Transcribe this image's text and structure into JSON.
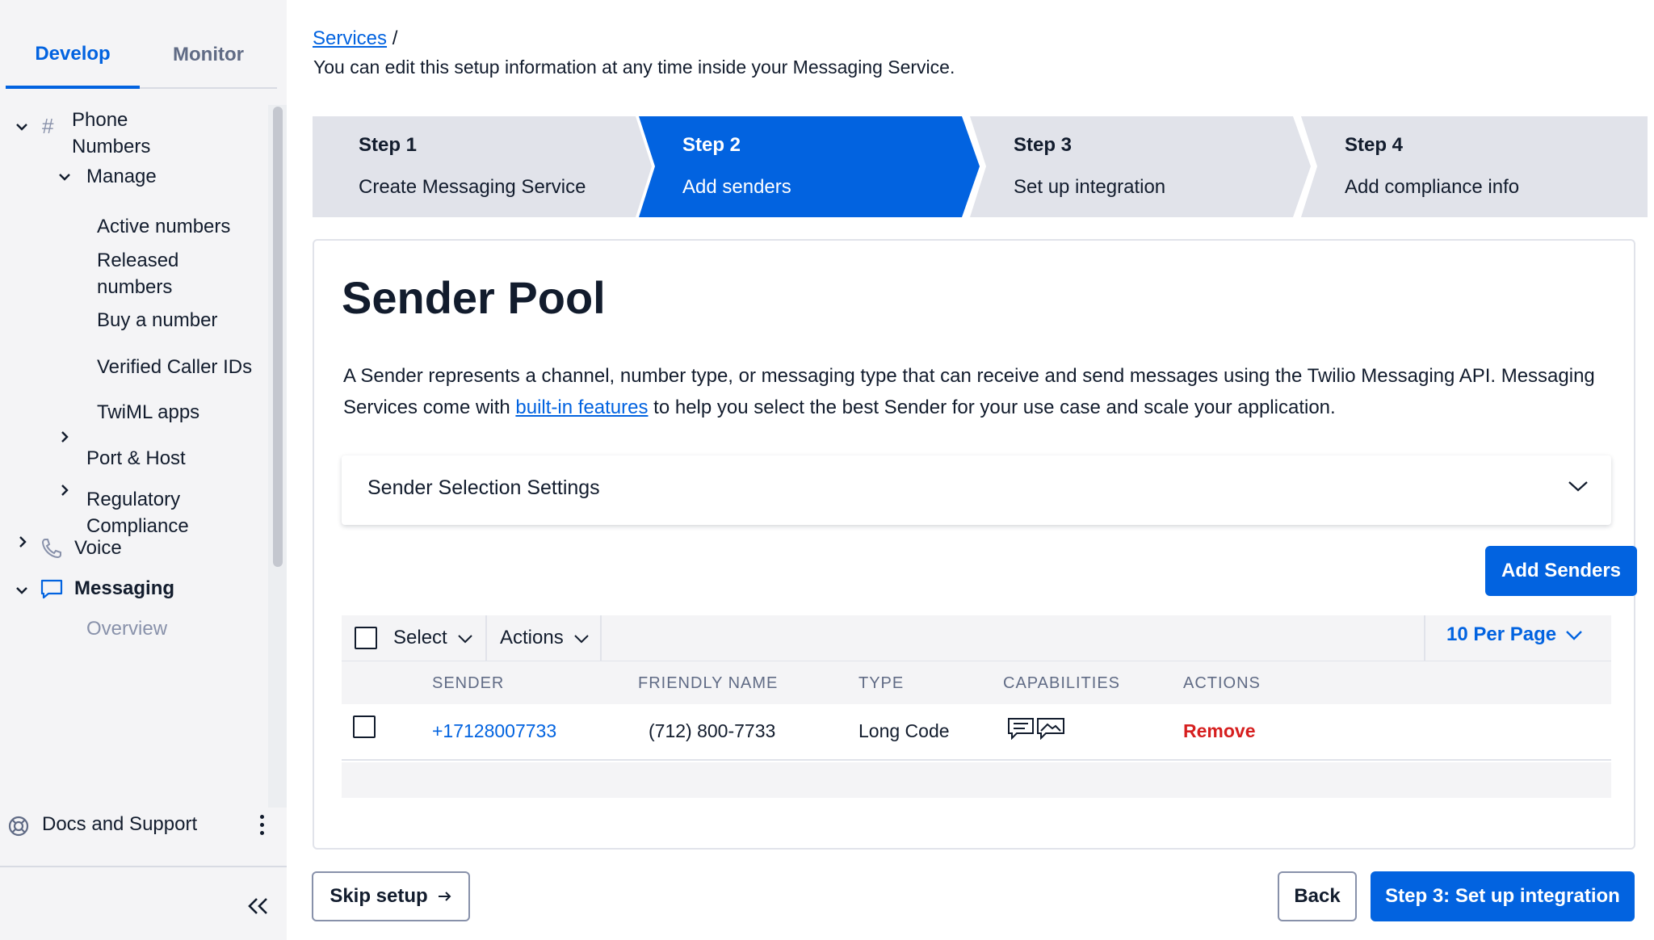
{
  "sidebar": {
    "tabs": [
      {
        "label": "Develop",
        "active": true
      },
      {
        "label": "Monitor",
        "active": false
      }
    ],
    "items": {
      "phone_numbers": "Phone\nNumbers",
      "phone_numbers_line1": "Phone",
      "phone_numbers_line2": "Numbers",
      "manage": "Manage",
      "active_numbers": "Active numbers",
      "released_line1": "Released",
      "released_line2": "numbers",
      "buy_number": "Buy a number",
      "verified_caller_ids": "Verified Caller IDs",
      "twiml_apps": "TwiML apps",
      "port_host": "Port & Host",
      "regulatory_line1": "Regulatory",
      "regulatory_line2": "Compliance",
      "voice": "Voice",
      "messaging": "Messaging",
      "overview": "Overview"
    },
    "docs_support": "Docs and Support"
  },
  "breadcrumb": {
    "link": "Services",
    "separator": "/"
  },
  "intro": "You can edit this setup information at any time inside your Messaging Service.",
  "steps": [
    {
      "number": "Step 1",
      "label": "Create Messaging Service",
      "active": false
    },
    {
      "number": "Step 2",
      "label": "Add senders",
      "active": true
    },
    {
      "number": "Step 3",
      "label": "Set up integration",
      "active": false
    },
    {
      "number": "Step 4",
      "label": "Add compliance info",
      "active": false
    }
  ],
  "card": {
    "title": "Sender Pool",
    "desc_before": "A Sender represents a channel, number type, or messaging type that can receive and send messages using the Twilio Messaging API. Messaging Services come with ",
    "desc_link": "built-in features",
    "desc_after": " to help you select the best Sender for your use case and scale your application.",
    "accordion_label": "Sender Selection Settings",
    "add_senders": "Add Senders"
  },
  "table": {
    "toolbar": {
      "select": "Select",
      "actions": "Actions",
      "per_page": "10 Per Page"
    },
    "columns": [
      "SENDER",
      "FRIENDLY NAME",
      "TYPE",
      "CAPABILITIES",
      "ACTIONS"
    ],
    "rows": [
      {
        "sender": "+17128007733",
        "friendly_name": "(712) 800-7733",
        "type": "Long Code",
        "capabilities": [
          "sms-icon",
          "mms-icon"
        ],
        "action": "Remove"
      }
    ]
  },
  "footer": {
    "skip": "Skip setup",
    "back": "Back",
    "next": "Step 3: Set up integration"
  },
  "colors": {
    "accent": "#0263e0",
    "danger": "#d61f1f",
    "text": "#121c2d",
    "muted": "#606b85"
  }
}
